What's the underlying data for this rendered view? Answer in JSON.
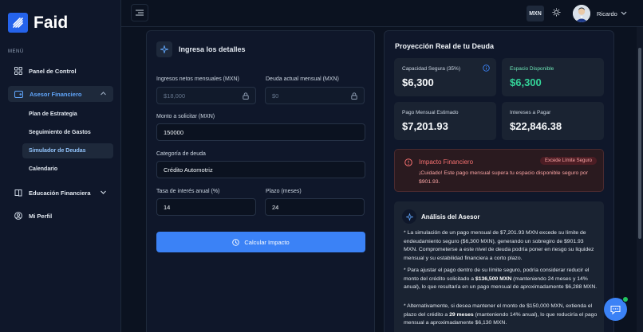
{
  "app": {
    "name": "Faid"
  },
  "sidebar": {
    "heading": "MENÚ",
    "items": [
      {
        "label": "Panel de Control",
        "icon": "grid-icon"
      },
      {
        "label": "Asesor Financiero",
        "icon": "wallet-icon",
        "expanded": true
      },
      {
        "label": "Educación Financiera",
        "icon": "book-icon"
      },
      {
        "label": "Mi Perfil",
        "icon": "user-icon"
      }
    ],
    "sub_items": [
      {
        "label": "Plan de Estrategia"
      },
      {
        "label": "Seguimiento de Gastos"
      },
      {
        "label": "Simulador de Deudas",
        "active": true
      },
      {
        "label": "Calendario"
      }
    ]
  },
  "topbar": {
    "currency": "MXN",
    "user_name": "Ricardo"
  },
  "form": {
    "title": "Ingresa los detalles",
    "income_label": "Ingresos netos mensuales (MXN)",
    "income_placeholder": "$18,000",
    "debt_label": "Deuda actual mensual (MXN)",
    "debt_placeholder": "$0",
    "amount_label": "Monto a solicitar (MXN)",
    "amount_value": "150000",
    "category_label": "Categoría de deuda",
    "category_value": "Crédito Automotriz",
    "rate_label": "Tasa de interés anual (%)",
    "rate_value": "14",
    "term_label": "Plazo (meses)",
    "term_value": "24",
    "calc_button": "Calcular Impacto"
  },
  "projection": {
    "title": "Proyección Real de tu Deuda",
    "stats": [
      {
        "label": "Capacidad Segura (35%)",
        "value": "$6,300"
      },
      {
        "label": "Espacio Disponible",
        "value": "$6,300"
      },
      {
        "label": "Pago Mensual Estimado",
        "value": "$7,201.93"
      },
      {
        "label": "Intereses a Pagar",
        "value": "$22,846.38"
      }
    ]
  },
  "alert": {
    "title": "Impacto Financiero",
    "badge": "Excede Límite Seguro",
    "message": "¡Cuidado! Este pago mensual supera tu espacio disponible seguro por $901.93."
  },
  "analysis": {
    "title": "Análisis del Asesor",
    "p1": "* La simulación de un pago mensual de $7,201.93 MXN excede su límite de endeudamiento seguro ($6,300 MXN), generando un sobregiro de $901.93 MXN. Comprometerse a este nivel de deuda podría poner en riesgo su liquidez mensual y su estabilidad financiera a corto plazo.",
    "p2_a": "* Para ajustar el pago dentro de su límite seguro, podría considerar reducir el monto del crédito solicitado a ",
    "p2_b": "$136,500 MXN",
    "p2_c": " (manteniendo 24 meses y 14% anual), lo que resultaría en un pago mensual de aproximadamente $6,288 MXN.",
    "p3_a": "* Alternativamente, si desea mantener el monto de $150,000 MXN, extienda el plazo del crédito a ",
    "p3_b": "29 meses",
    "p3_c": " (manteniendo 14% anual), lo que reduciría el pago mensual a aproximadamente $6,130 MXN."
  }
}
